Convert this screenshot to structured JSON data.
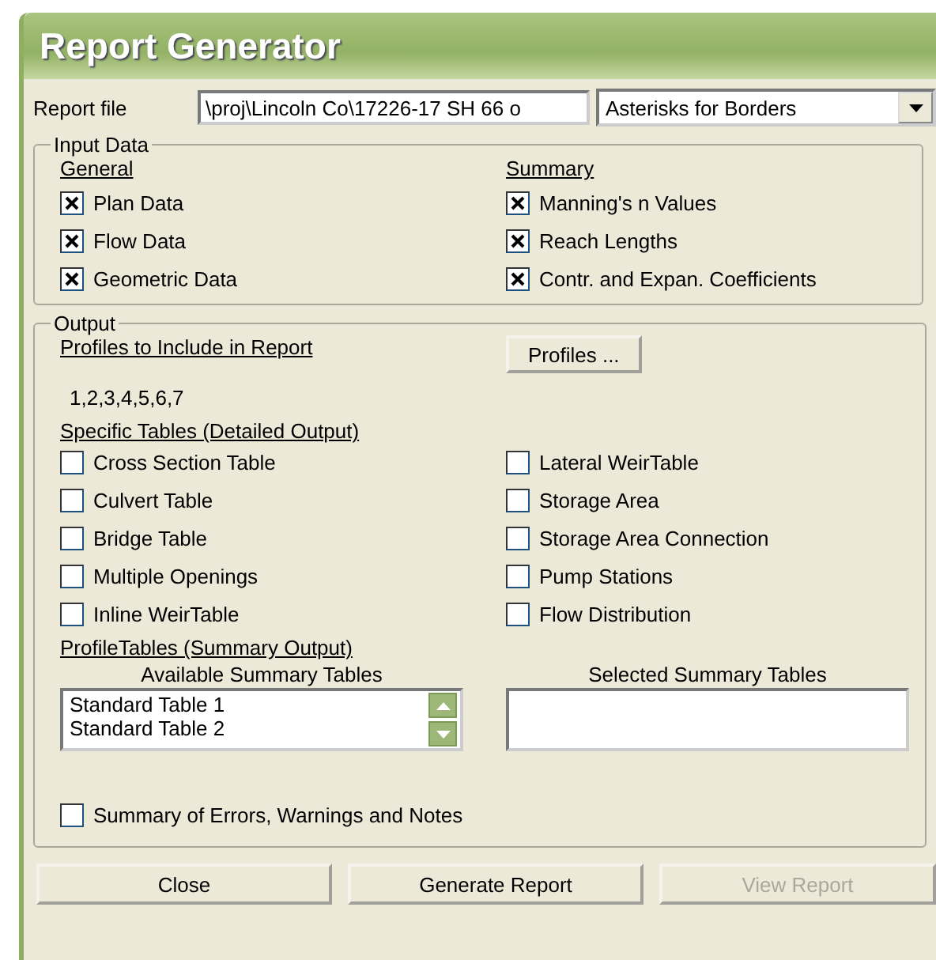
{
  "window": {
    "title": "Report Generator"
  },
  "report_file": {
    "label": "Report file",
    "value": "\\proj\\Lincoln Co\\17226-17 SH 66 o",
    "border_style": "Asterisks for Borders"
  },
  "input_data": {
    "title": "Input Data",
    "general": {
      "heading": "General",
      "items": [
        {
          "label": "Plan Data",
          "checked": true
        },
        {
          "label": "Flow Data",
          "checked": true
        },
        {
          "label": "Geometric Data",
          "checked": true
        }
      ]
    },
    "summary": {
      "heading": "Summary",
      "items": [
        {
          "label": "Manning's n Values",
          "checked": true
        },
        {
          "label": "Reach Lengths",
          "checked": true
        },
        {
          "label": "Contr. and Expan. Coefficients",
          "checked": true
        }
      ]
    }
  },
  "output": {
    "title": "Output",
    "profiles_heading": "Profiles to Include in Report",
    "profiles_button": "Profiles ...",
    "profiles": "1,2,3,4,5,6,7",
    "specific_heading": "Specific Tables (Detailed Output)",
    "left_tables": [
      {
        "label": "Cross Section Table",
        "checked": false
      },
      {
        "label": "Culvert Table",
        "checked": false
      },
      {
        "label": "Bridge Table",
        "checked": false
      },
      {
        "label": "Multiple Openings",
        "checked": false
      },
      {
        "label": "Inline WeirTable",
        "checked": false
      }
    ],
    "right_tables": [
      {
        "label": "Lateral WeirTable",
        "checked": false
      },
      {
        "label": "Storage Area",
        "checked": false
      },
      {
        "label": "Storage Area Connection",
        "checked": false
      },
      {
        "label": "Pump Stations",
        "checked": false
      },
      {
        "label": "Flow Distribution",
        "checked": false
      }
    ],
    "profile_tables_heading": "ProfileTables (Summary Output)",
    "available": {
      "label": "Available Summary Tables",
      "items": [
        "Standard Table 1",
        "Standard Table 2"
      ]
    },
    "selected": {
      "label": "Selected Summary Tables"
    },
    "errors_summary": {
      "label": "Summary of Errors, Warnings and Notes",
      "checked": false
    }
  },
  "buttons": [
    {
      "label": "Close",
      "disabled": false
    },
    {
      "label": "Generate Report",
      "disabled": false
    },
    {
      "label": "View Report",
      "disabled": true
    }
  ]
}
